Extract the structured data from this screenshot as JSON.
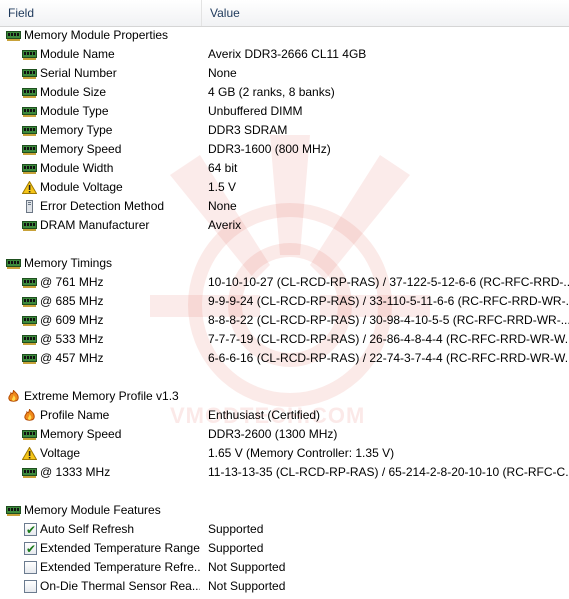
{
  "header": {
    "field": "Field",
    "value": "Value"
  },
  "watermark": "VMODTECH.COM",
  "sections": [
    {
      "title": "Memory Module Properties",
      "icon": "memory-module-icon",
      "rows": [
        {
          "field": "Module Name",
          "value": "Averix DDR3-2666 CL11 4GB",
          "icon": "memory-module-icon"
        },
        {
          "field": "Serial Number",
          "value": "None",
          "icon": "memory-module-icon"
        },
        {
          "field": "Module Size",
          "value": "4 GB (2 ranks, 8 banks)",
          "icon": "memory-module-icon"
        },
        {
          "field": "Module Type",
          "value": "Unbuffered DIMM",
          "icon": "memory-module-icon"
        },
        {
          "field": "Memory Type",
          "value": "DDR3 SDRAM",
          "icon": "memory-module-icon"
        },
        {
          "field": "Memory Speed",
          "value": "DDR3-1600 (800 MHz)",
          "icon": "memory-module-icon"
        },
        {
          "field": "Module Width",
          "value": "64 bit",
          "icon": "memory-module-icon"
        },
        {
          "field": "Module Voltage",
          "value": "1.5 V",
          "icon": "warning-icon"
        },
        {
          "field": "Error Detection Method",
          "value": "None",
          "icon": "device-icon"
        },
        {
          "field": "DRAM Manufacturer",
          "value": "Averix",
          "icon": "memory-module-icon"
        }
      ]
    },
    {
      "title": "Memory Timings",
      "icon": "memory-module-icon",
      "rows": [
        {
          "field": "@ 761 MHz",
          "value": "10-10-10-27  (CL-RCD-RP-RAS) / 37-122-5-12-6-6  (RC-RFC-RRD-...",
          "icon": "memory-module-icon"
        },
        {
          "field": "@ 685 MHz",
          "value": "9-9-9-24  (CL-RCD-RP-RAS) / 33-110-5-11-6-6  (RC-RFC-RRD-WR-...",
          "icon": "memory-module-icon"
        },
        {
          "field": "@ 609 MHz",
          "value": "8-8-8-22  (CL-RCD-RP-RAS) / 30-98-4-10-5-5  (RC-RFC-RRD-WR-...",
          "icon": "memory-module-icon"
        },
        {
          "field": "@ 533 MHz",
          "value": "7-7-7-19  (CL-RCD-RP-RAS) / 26-86-4-8-4-4  (RC-RFC-RRD-WR-W...",
          "icon": "memory-module-icon"
        },
        {
          "field": "@ 457 MHz",
          "value": "6-6-6-16  (CL-RCD-RP-RAS) / 22-74-3-7-4-4  (RC-RFC-RRD-WR-W...",
          "icon": "memory-module-icon"
        }
      ]
    },
    {
      "title": "Extreme Memory Profile v1.3",
      "icon": "flame-icon",
      "rows": [
        {
          "field": "Profile Name",
          "value": "Enthusiast (Certified)",
          "icon": "flame-icon"
        },
        {
          "field": "Memory Speed",
          "value": "DDR3-2600 (1300 MHz)",
          "icon": "memory-module-icon"
        },
        {
          "field": "Voltage",
          "value": "1.65 V  (Memory Controller: 1.35 V)",
          "icon": "warning-icon"
        },
        {
          "field": "@ 1333 MHz",
          "value": "11-13-13-35  (CL-RCD-RP-RAS) / 65-214-2-8-20-10-10  (RC-RFC-C...",
          "icon": "memory-module-icon"
        }
      ]
    },
    {
      "title": "Memory Module Features",
      "icon": "memory-module-icon",
      "rows": [
        {
          "field": "Auto Self Refresh",
          "value": "Supported",
          "icon": "checkbox",
          "checked": true
        },
        {
          "field": "Extended Temperature Range",
          "value": "Supported",
          "icon": "checkbox",
          "checked": true
        },
        {
          "field": "Extended Temperature Refre...",
          "value": "Not Supported",
          "icon": "checkbox",
          "checked": false
        },
        {
          "field": "On-Die Thermal Sensor Rea...",
          "value": "Not Supported",
          "icon": "checkbox",
          "checked": false
        }
      ]
    }
  ]
}
